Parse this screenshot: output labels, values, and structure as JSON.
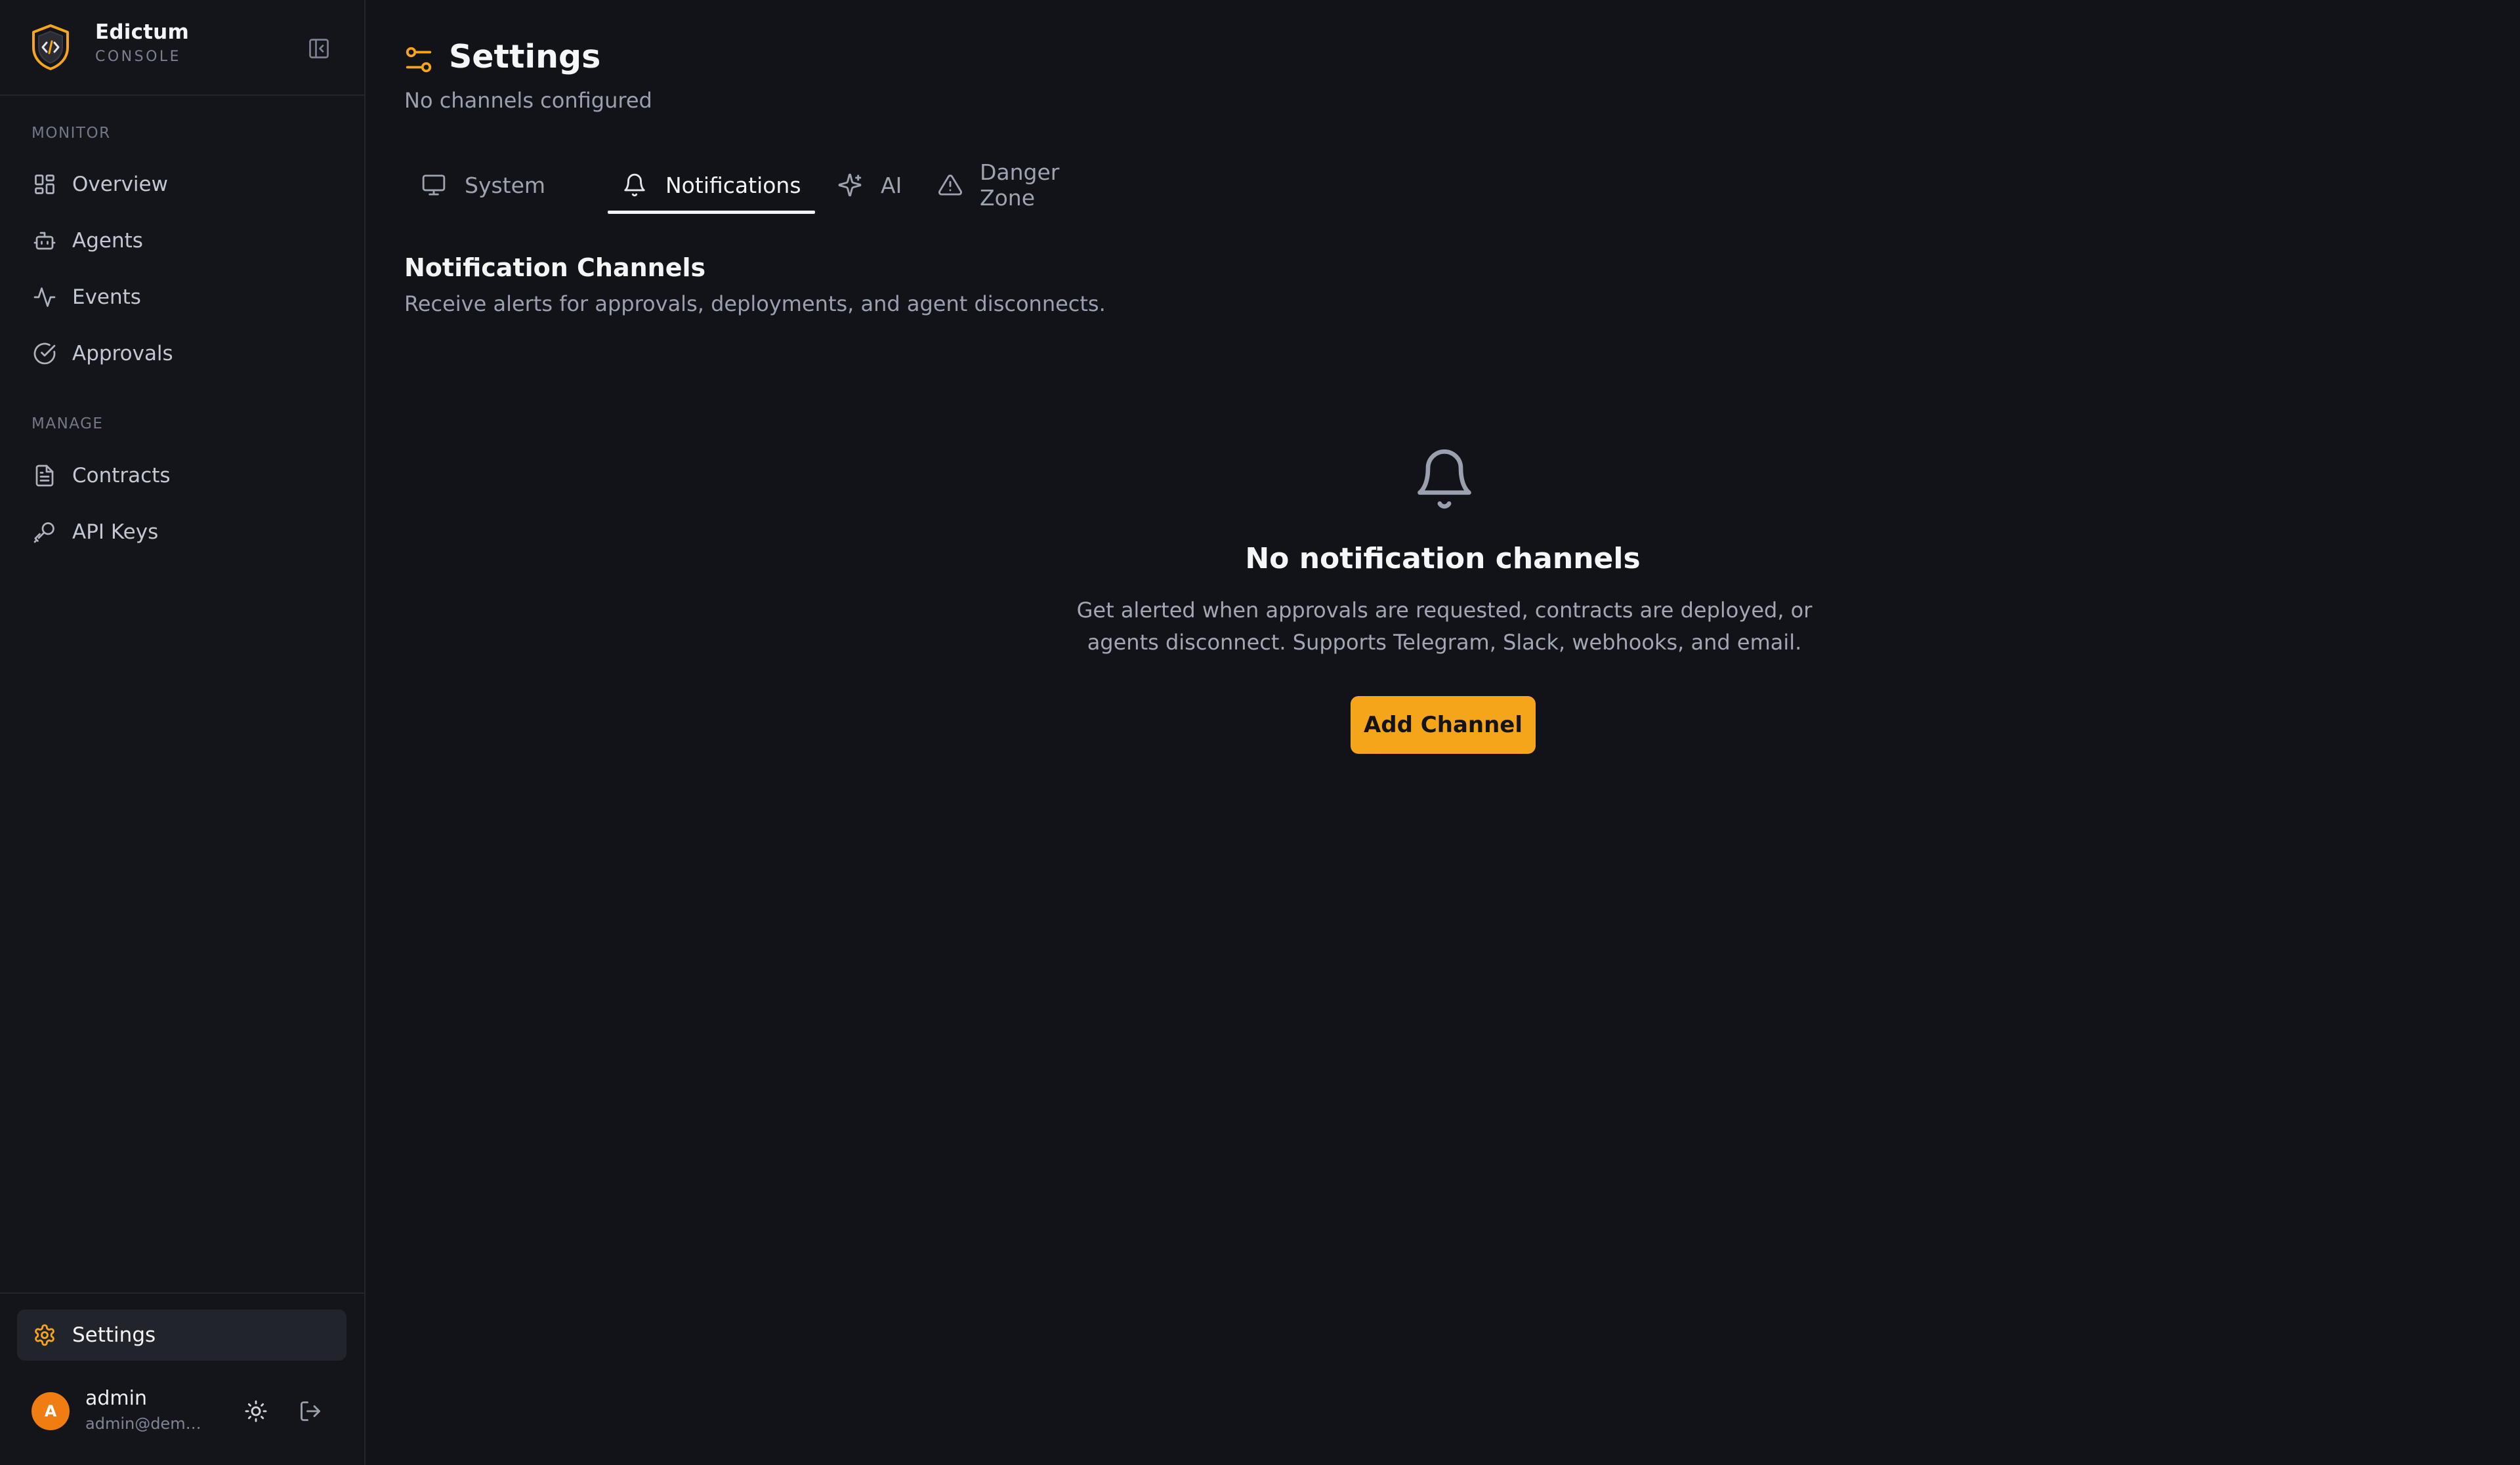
{
  "brand": {
    "name": "Edictum",
    "subtitle": "CONSOLE",
    "accent": "#f5a51a"
  },
  "sidebar": {
    "sections": [
      {
        "label": "MONITOR",
        "items": [
          {
            "label": "Overview",
            "icon": "layout-grid-icon"
          },
          {
            "label": "Agents",
            "icon": "bot-icon"
          },
          {
            "label": "Events",
            "icon": "activity-icon"
          },
          {
            "label": "Approvals",
            "icon": "check-circle-icon"
          }
        ]
      },
      {
        "label": "MANAGE",
        "items": [
          {
            "label": "Contracts",
            "icon": "file-text-icon"
          },
          {
            "label": "API Keys",
            "icon": "key-icon"
          }
        ]
      }
    ],
    "settings": {
      "label": "Settings",
      "icon": "gear-icon",
      "active": true
    },
    "user": {
      "avatar_initial": "A",
      "name": "admin",
      "email": "admin@demo.t..."
    }
  },
  "page": {
    "title": "Settings",
    "subtitle": "No channels configured",
    "tabs": [
      {
        "label": "System",
        "icon": "monitor-icon",
        "active": false
      },
      {
        "label": "Notifications",
        "icon": "bell-icon",
        "active": true
      },
      {
        "label": "AI",
        "icon": "sparkles-icon",
        "active": false
      },
      {
        "label": "Danger Zone",
        "icon": "warning-triangle-icon",
        "active": false
      }
    ],
    "section": {
      "title": "Notification Channels",
      "description": "Receive alerts for approvals, deployments, and agent disconnects."
    },
    "empty_state": {
      "title": "No notification channels",
      "description": "Get alerted when approvals are requested, contracts are deployed, or agents disconnect. Supports Telegram, Slack, webhooks, and email.",
      "button_label": "Add Channel"
    }
  }
}
